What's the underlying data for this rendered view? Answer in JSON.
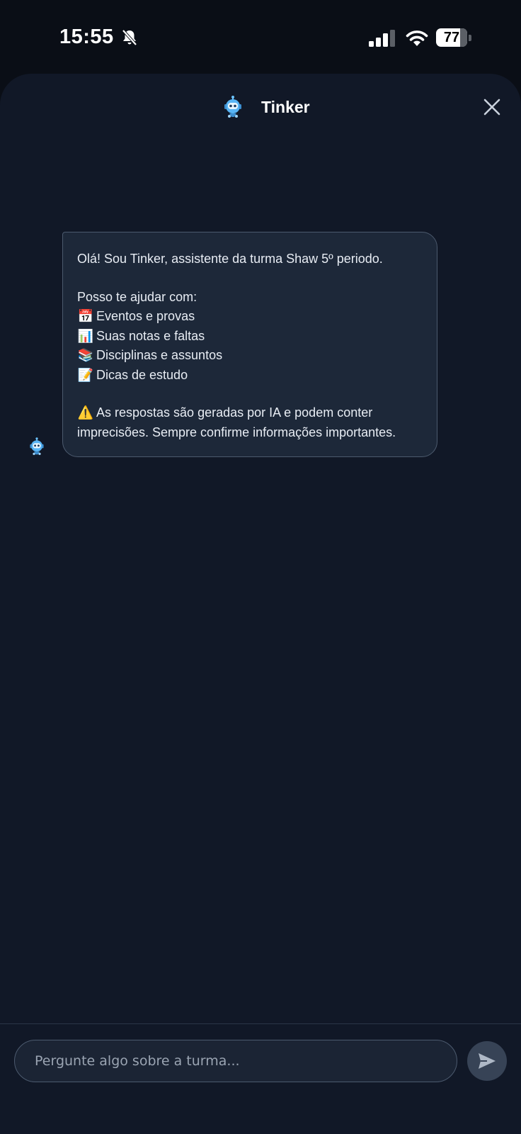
{
  "status_bar": {
    "time": "15:55",
    "battery": "77",
    "battery_level": 0.77,
    "icons": [
      "bell-muted-icon",
      "signal-icon",
      "wifi-icon",
      "battery-icon"
    ]
  },
  "header": {
    "title": "Tinker",
    "avatar_icon": "robot-icon",
    "close_icon": "close-icon"
  },
  "messages": [
    {
      "sender": "bot",
      "greeting": "Olá! Sou Tinker, assistente da turma Shaw 5º periodo.",
      "intro": "Posso te ajudar com:",
      "items": [
        {
          "emoji": "📅",
          "text": "Eventos e provas"
        },
        {
          "emoji": "📊",
          "text": "Suas notas e faltas"
        },
        {
          "emoji": "📚",
          "text": "Disciplinas e assuntos"
        },
        {
          "emoji": "📝",
          "text": "Dicas de estudo"
        }
      ],
      "warning_emoji": "⚠️",
      "warning": "As respostas são geradas por IA e podem conter imprecisões. Sempre confirme informações importantes."
    }
  ],
  "composer": {
    "placeholder": "Pergunte algo sobre a turma...",
    "value": "",
    "send_icon": "send-icon"
  },
  "colors": {
    "background": "#111827",
    "bubble": "#1d2839",
    "bubble_border": "#4c5a6e",
    "send_button": "#374356"
  }
}
